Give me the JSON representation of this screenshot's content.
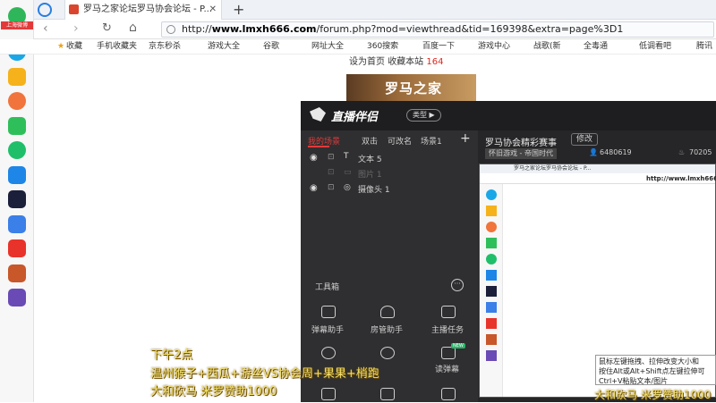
{
  "browser": {
    "tab_title": "罗马之家论坛罗马协会论坛 - P...",
    "new_tab": "+",
    "close_tab": "✕",
    "url_prefix": "http://",
    "url_domain": "www.lmxh666.com",
    "url_path": "/forum.php?mod=viewthread&tid=169398&extra=page%3D1",
    "bookmarks": [
      "收藏",
      "手机收藏夹",
      "京东秒杀",
      "游戏大全",
      "谷歌",
      "网址大全",
      "360搜索",
      "百度一下",
      "游戏中心",
      "战歌(新",
      "全毒通",
      "低调看吧",
      "腾讯"
    ]
  },
  "sidebar": {
    "top_label": "上海微博",
    "apps": [
      "app1",
      "app2",
      "app3",
      "app4",
      "app5",
      "app6",
      "app7",
      "app8",
      "app9",
      "app10",
      "app11"
    ]
  },
  "page": {
    "set_home": "设为首页",
    "bookmark_site": "收藏本站",
    "count": "164",
    "banner": "罗马之家"
  },
  "obs": {
    "brand": "直播伴侣",
    "mode_btn": "类型 ▶",
    "scene_tabs": [
      "我的场景",
      "双击",
      "可改名",
      "场景1"
    ],
    "add": "+",
    "sources": [
      {
        "name": "文本 5",
        "visible": true
      },
      {
        "name": "图片 1",
        "visible": false
      },
      {
        "name": "摄像头 1",
        "visible": true
      }
    ],
    "stream_title": "罗马协会精彩赛事",
    "edit_btn": "修改",
    "game_tag": "怀旧游戏 - 帝国时代",
    "viewer_id": "6480619",
    "hot": "70205",
    "toolbox_title": "工具箱",
    "tools": [
      "弹幕助手",
      "房管助手",
      "主播任务",
      "",
      "",
      "读弹幕",
      "",
      "",
      ""
    ],
    "tool_badges": {
      "label": "NEW"
    }
  },
  "inner": {
    "url": "http://www.lmxh666.com",
    "tab": "罗马之家论坛罗马协会论坛 - P..."
  },
  "tooltip": {
    "line1": "鼠标左键拖拽、拉伸改变大小和",
    "line2": "按住Alt或Alt+Shift点左键拉伸可",
    "line3": "Ctrl+V粘贴文本/图片"
  },
  "caption": {
    "line1": "下午2点",
    "line2": "温州猴子+西瓜+游丝VS协会周+果果+梢跑",
    "line3": "大和砍马 米罗赞助1000",
    "line4": "大和砍马 米罗赞助1000"
  },
  "colors": {
    "accent_red": "#e23a3a",
    "caption_yellow": "#f3e06a",
    "obs_bg": "#2b2b2d"
  }
}
